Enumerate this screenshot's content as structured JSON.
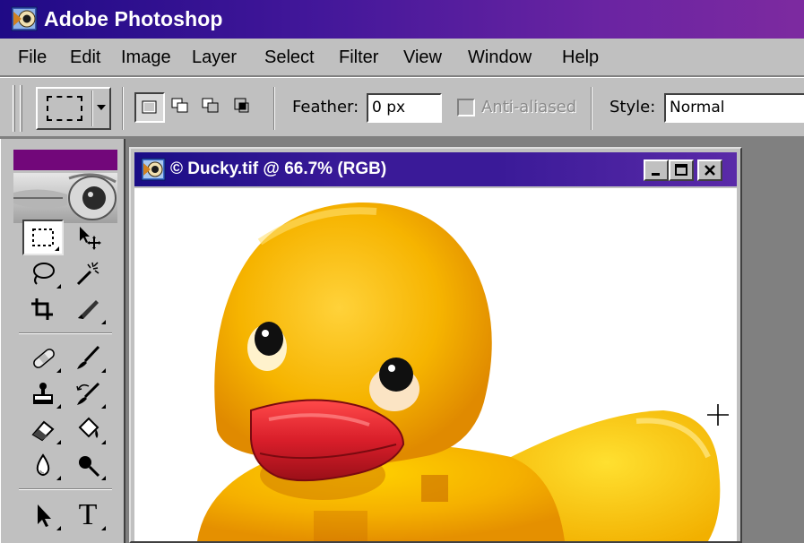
{
  "app": {
    "title": "Adobe Photoshop",
    "icon": "photoshop-eye-icon"
  },
  "menu": {
    "items": [
      {
        "label": "File"
      },
      {
        "label": "Edit"
      },
      {
        "label": "Image"
      },
      {
        "label": "Layer"
      },
      {
        "label": "Select"
      },
      {
        "label": "Filter"
      },
      {
        "label": "View"
      },
      {
        "label": "Window"
      },
      {
        "label": "Help"
      }
    ]
  },
  "options": {
    "preset_icon": "rectangular-marquee-icon",
    "selection_modes": [
      {
        "name": "new-selection",
        "active": true
      },
      {
        "name": "add-to-selection",
        "active": false
      },
      {
        "name": "subtract-from-selection",
        "active": false
      },
      {
        "name": "intersect-with-selection",
        "active": false
      }
    ],
    "feather_label": "Feather:",
    "feather_value": "0 px",
    "anti_aliased_label": "Anti-aliased",
    "anti_aliased_checked": false,
    "style_label": "Style:",
    "style_value": "Normal"
  },
  "toolbox": {
    "tools": [
      "rectangular-marquee",
      "move",
      "lasso",
      "magic-wand",
      "crop",
      "slice",
      "healing-brush",
      "brush",
      "clone-stamp",
      "history-brush",
      "eraser",
      "paint-bucket",
      "blur",
      "dodge",
      "path-selection",
      "type"
    ],
    "active_tool": "rectangular-marquee",
    "type_tool_glyph": "T"
  },
  "document": {
    "title": "© Ducky.tif @ 66.7% (RGB)",
    "zoom": "66.7%",
    "color_mode": "RGB",
    "controls": {
      "minimize": "_",
      "maximize": "□",
      "close": "×"
    }
  },
  "colors": {
    "app_title_start": "#1f0a86",
    "app_title_end": "#7d2aa0",
    "chrome": "#c0c0c0",
    "workspace": "#808080",
    "duck_yellow": "#f5b800",
    "duck_bill": "#d3202a"
  }
}
